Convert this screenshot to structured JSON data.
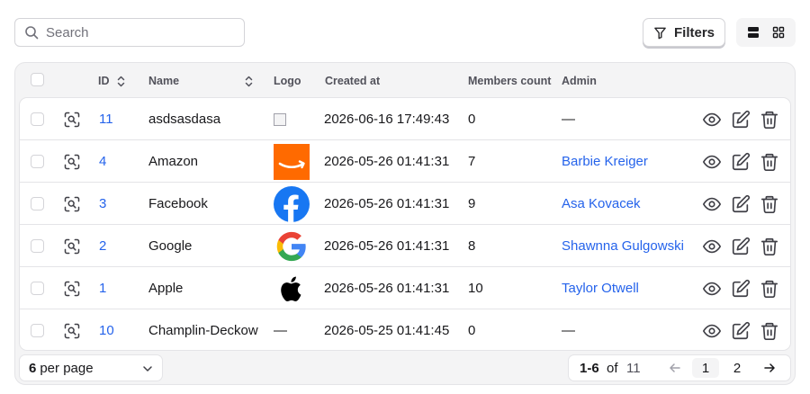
{
  "search": {
    "placeholder": "Search"
  },
  "toolbar": {
    "filters_label": "Filters"
  },
  "table": {
    "columns": {
      "id": "ID",
      "name": "Name",
      "logo": "Logo",
      "created_at": "Created at",
      "members_count": "Members count",
      "admin": "Admin"
    },
    "rows": [
      {
        "id": "11",
        "name": "asdsasdasa",
        "logo": "broken-image-icon",
        "created_at": "2026-06-16 17:49:43",
        "members": "0",
        "admin": "—"
      },
      {
        "id": "4",
        "name": "Amazon",
        "logo": "amazon-logo",
        "created_at": "2026-05-26 01:41:31",
        "members": "7",
        "admin": "Barbie Kreiger"
      },
      {
        "id": "3",
        "name": "Facebook",
        "logo": "facebook-logo",
        "created_at": "2026-05-26 01:41:31",
        "members": "9",
        "admin": "Asa Kovacek"
      },
      {
        "id": "2",
        "name": "Google",
        "logo": "google-logo",
        "created_at": "2026-05-26 01:41:31",
        "members": "8",
        "admin": "Shawnna Gulgowski"
      },
      {
        "id": "1",
        "name": "Apple",
        "logo": "apple-logo",
        "created_at": "2026-05-26 01:41:31",
        "members": "10",
        "admin": "Taylor Otwell"
      },
      {
        "id": "10",
        "name": "Champlin-Deckow",
        "logo": "—",
        "created_at": "2026-05-25 01:41:45",
        "members": "0",
        "admin": "—"
      }
    ]
  },
  "footer": {
    "per_page_value": "6",
    "per_page_label": "per page",
    "range": "1-6",
    "of": "of",
    "total": "11",
    "pages": [
      "1",
      "2"
    ]
  },
  "colors": {
    "link": "#2563eb",
    "border": "#e4e4e7",
    "panel": "#f4f4f5",
    "amazon": "#ff6a00",
    "facebook": "#1877f2"
  }
}
